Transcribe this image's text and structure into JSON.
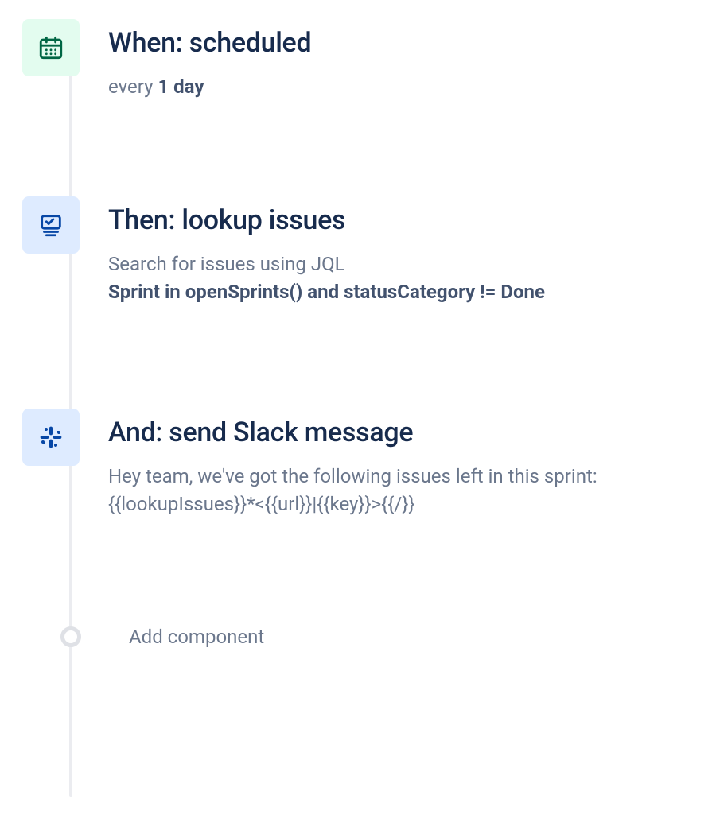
{
  "steps": [
    {
      "title": "When: scheduled",
      "desc_prefix": "every ",
      "desc_bold": "1 day",
      "desc_suffix": ""
    },
    {
      "title": "Then: lookup issues",
      "desc_prefix": "Search for issues using JQL\n",
      "desc_bold": "Sprint in openSprints() and statusCategory != Done",
      "desc_suffix": ""
    },
    {
      "title": "And: send Slack message",
      "desc_prefix": "Hey team, we've got the following issues left in this sprint:\n{{lookupIssues}}*<{{url}}|{{key}}>{{/}}",
      "desc_bold": "",
      "desc_suffix": ""
    }
  ],
  "add_component": "Add component"
}
